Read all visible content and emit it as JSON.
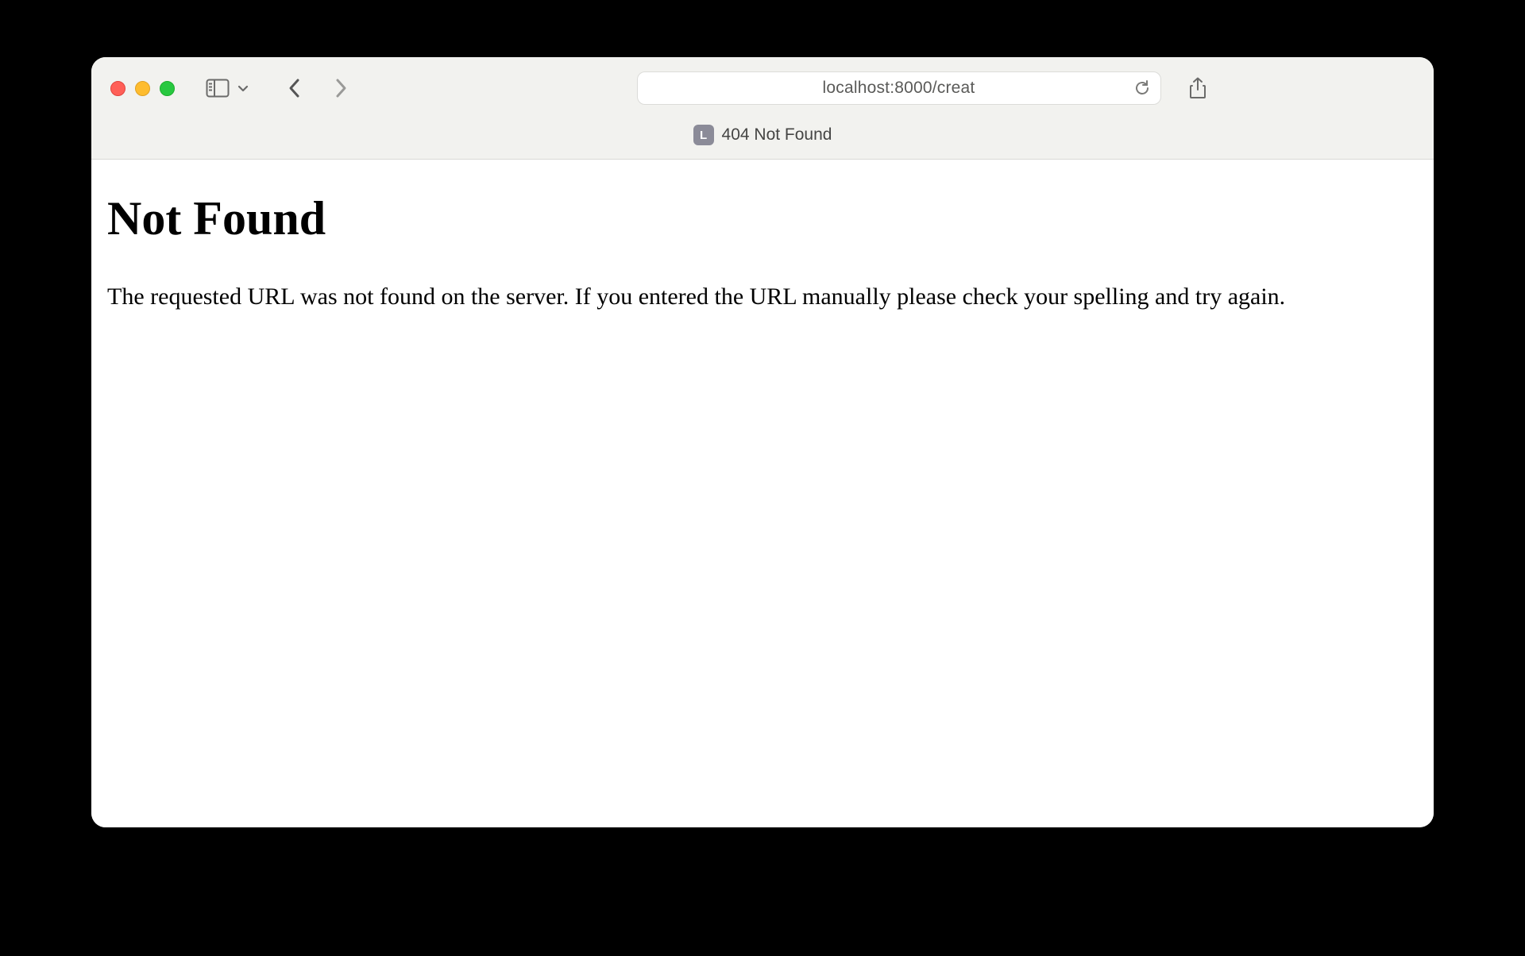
{
  "toolbar": {
    "address": "localhost:8000/creat",
    "favicon_letter": "L",
    "tab_title": "404 Not Found"
  },
  "page": {
    "heading": "Not Found",
    "message": "The requested URL was not found on the server. If you entered the URL manually please check your spelling and try again."
  }
}
